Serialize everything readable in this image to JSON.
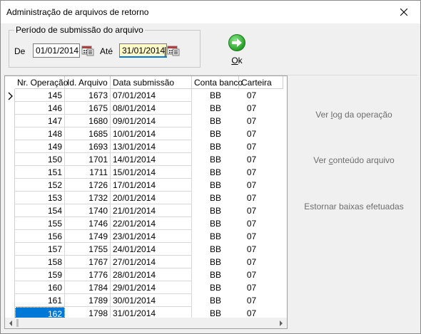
{
  "window": {
    "title": "Administração de arquivos de retorno"
  },
  "period": {
    "legend": "Período de submissão do arquivo",
    "from_label": "De",
    "from_value": "01/01/2014",
    "to_label": "Até",
    "to_value": "31/01/2014"
  },
  "ok_button": {
    "label_accel": "O",
    "label_rest": "k"
  },
  "grid": {
    "columns": [
      "Nr. Operação",
      "Id. Arquivo",
      "Data submissão",
      "Conta banco",
      "Carteira"
    ],
    "rows": [
      [
        "145",
        "1673",
        "07/01/2014",
        "BB",
        "07"
      ],
      [
        "146",
        "1675",
        "08/01/2014",
        "BB",
        "07"
      ],
      [
        "147",
        "1680",
        "09/01/2014",
        "BB",
        "07"
      ],
      [
        "148",
        "1685",
        "10/01/2014",
        "BB",
        "07"
      ],
      [
        "149",
        "1693",
        "13/01/2014",
        "BB",
        "07"
      ],
      [
        "150",
        "1701",
        "14/01/2014",
        "BB",
        "07"
      ],
      [
        "151",
        "1711",
        "15/01/2014",
        "BB",
        "07"
      ],
      [
        "152",
        "1726",
        "17/01/2014",
        "BB",
        "07"
      ],
      [
        "153",
        "1732",
        "20/01/2014",
        "BB",
        "07"
      ],
      [
        "154",
        "1740",
        "21/01/2014",
        "BB",
        "07"
      ],
      [
        "155",
        "1746",
        "22/01/2014",
        "BB",
        "07"
      ],
      [
        "156",
        "1749",
        "23/01/2014",
        "BB",
        "07"
      ],
      [
        "157",
        "1755",
        "24/01/2014",
        "BB",
        "07"
      ],
      [
        "158",
        "1767",
        "27/01/2014",
        "BB",
        "07"
      ],
      [
        "159",
        "1776",
        "28/01/2014",
        "BB",
        "07"
      ],
      [
        "160",
        "1784",
        "29/01/2014",
        "BB",
        "07"
      ],
      [
        "161",
        "1789",
        "30/01/2014",
        "BB",
        "07"
      ],
      [
        "162",
        "1798",
        "31/01/2014",
        "BB",
        "07"
      ]
    ]
  },
  "actions": {
    "view_log_prefix": "Ver ",
    "view_log_accel": "l",
    "view_log_suffix": "og da operação",
    "view_content_prefix": "Ver ",
    "view_content_accel": "c",
    "view_content_suffix": "onteúdo arquivo",
    "reverse_label": "Estornar baixas efetuadas"
  },
  "icons": {
    "close": "close-icon",
    "calendar": "calendar-icon",
    "ok": "green-arrow-icon",
    "row_pointer": "row-pointer-icon"
  },
  "colors": {
    "selection": "#0078d7",
    "active_field": "#fffac8",
    "ok_green": "#2fb52f",
    "link_gray": "#6d6d6d"
  }
}
